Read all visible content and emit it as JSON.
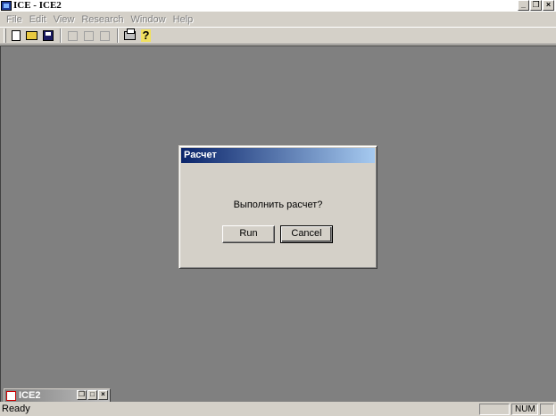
{
  "window": {
    "title": "ICE - ICE2",
    "controls": [
      "_",
      "❒",
      "×"
    ]
  },
  "menu": [
    "File",
    "Edit",
    "View",
    "Research",
    "Window",
    "Help"
  ],
  "toolbar": {
    "buttons": [
      "new-icon",
      "open-icon",
      "save-icon",
      "cut-icon",
      "copy-icon",
      "paste-icon",
      "print-icon",
      "help-icon"
    ]
  },
  "dialog": {
    "title": "Расчет",
    "message": "Выполнить расчет?",
    "run_label": "Run",
    "cancel_label": "Cancel"
  },
  "minimized_child": {
    "title": "ICE2",
    "controls": [
      "❒",
      "□",
      "×"
    ]
  },
  "status": {
    "text": "Ready",
    "pane_num": "NUM"
  },
  "colors": {
    "face": "#d4d0c8",
    "mdi_background": "#808080",
    "title_active_start": "#0a246a",
    "title_active_end": "#a6caf0"
  }
}
